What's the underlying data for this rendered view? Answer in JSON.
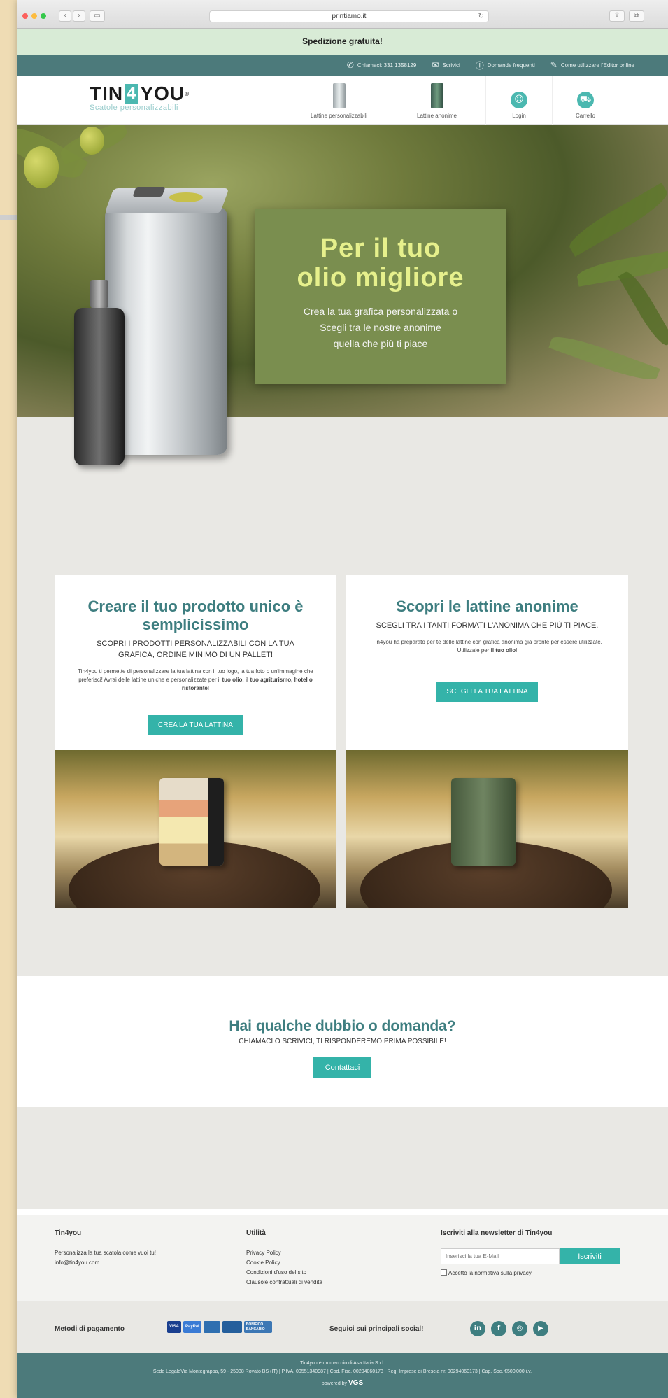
{
  "browser": {
    "url": "printiamo.it"
  },
  "promo": {
    "text": "Spedizione gratuita!"
  },
  "contactbar": {
    "items": [
      {
        "icon": "phone-icon",
        "label": "Chiamaci: 331 1358129"
      },
      {
        "icon": "mail-icon",
        "label": "Scrivici"
      },
      {
        "icon": "question-icon",
        "label": "Domande frequenti"
      },
      {
        "icon": "edit-icon",
        "label": "Come utilizzare l'Editor online"
      }
    ]
  },
  "header": {
    "logo_main_a": "TIN",
    "logo_main_four": "4",
    "logo_main_b": "YOU",
    "logo_reg": "®",
    "logo_sub": "Scatole personalizzabili",
    "nav": [
      {
        "icon": "custom-tin-icon",
        "label": "Lattine personalizzabili"
      },
      {
        "icon": "anonymous-tin-icon",
        "label": "Lattine anonime"
      },
      {
        "icon": "user-icon",
        "label": "Login"
      },
      {
        "icon": "cart-icon",
        "label": "Carrello"
      }
    ]
  },
  "hero": {
    "title_line1": "Per il tuo",
    "title_line2": "olio migliore",
    "text_line1": "Crea la tua grafica personalizzata o",
    "text_line2": "Scegli tra le nostre anonime",
    "text_line3": "quella che più ti piace"
  },
  "cards": [
    {
      "title": "Creare il tuo prodotto unico è semplicissimo",
      "caps": "Scopri i prodotti personalizzabili con la tua grafica, ordine minimo di un pallet!",
      "small_a": "Tin4you ti permette di personalizzare la tua lattina con il tuo logo, la tua foto o un'immagine che preferisci! Avrai delle lattine uniche e personalizzate per il ",
      "small_b": "tuo olio, il tuo agriturismo, hotel o ristorante",
      "small_c": "!",
      "button": "Crea la tua lattina"
    },
    {
      "title": "Scopri le lattine anonime",
      "caps": "Scegli tra i tanti formati l'anonima che più ti piace.",
      "small_a": "Tin4you ha preparato per te delle lattine con grafica anonima già pronte per essere utilizzate. Utilizzale per ",
      "small_b": "il tuo olio",
      "small_c": "!",
      "button": "Scegli la tua lattina"
    }
  ],
  "contact": {
    "title": "Hai qualche dubbio o domanda?",
    "subtitle": "Chiamaci o scrivici, ti risponderemo prima possibile!",
    "button": "Contattaci"
  },
  "footer": {
    "col1_title": "Tin4you",
    "col1_line1": "Personalizza la tua scatola come vuoi tu!",
    "col1_line2": "info@tin4you.com",
    "col2_title": "Utilità",
    "col2_links": [
      "Privacy Policy",
      "Cookie Policy",
      "Condizioni d'uso del sito",
      "Clausole contrattuali di vendita"
    ],
    "col3_title": "Iscriviti alla newsletter di Tin4you",
    "newsletter_placeholder": "Inserisci la tua E-Mail",
    "newsletter_button": "Iscriviti",
    "privacy_check": "Accetto la normativa sulla privacy",
    "payment_label": "Metodi di pagamento",
    "payment_methods": [
      "VISA",
      "PayPal",
      "MC",
      "CARD",
      "BONIFICO BANCARIO"
    ],
    "social_label": "Seguici sui principali social!",
    "socials": [
      {
        "icon": "linkedin-icon",
        "glyph": "in"
      },
      {
        "icon": "facebook-icon",
        "glyph": "f"
      },
      {
        "icon": "instagram-icon",
        "glyph": "◎"
      },
      {
        "icon": "youtube-icon",
        "glyph": "▶"
      }
    ],
    "legal_line1": "Tin4you è un marchio di Asa Italia S.r.l.",
    "legal_line2": "Sede LegaleVia Montegrappa, 59 - 25038 Rovato BS (IT) | P.IVA. 00551340987 | Cod. Fisc. 00294060173 | Reg. Imprese di Brescia nr. 00294060173 | Cap. Soc. €500'000 i.v.",
    "powered_by": "powered by",
    "powered_logo": "VGS"
  }
}
